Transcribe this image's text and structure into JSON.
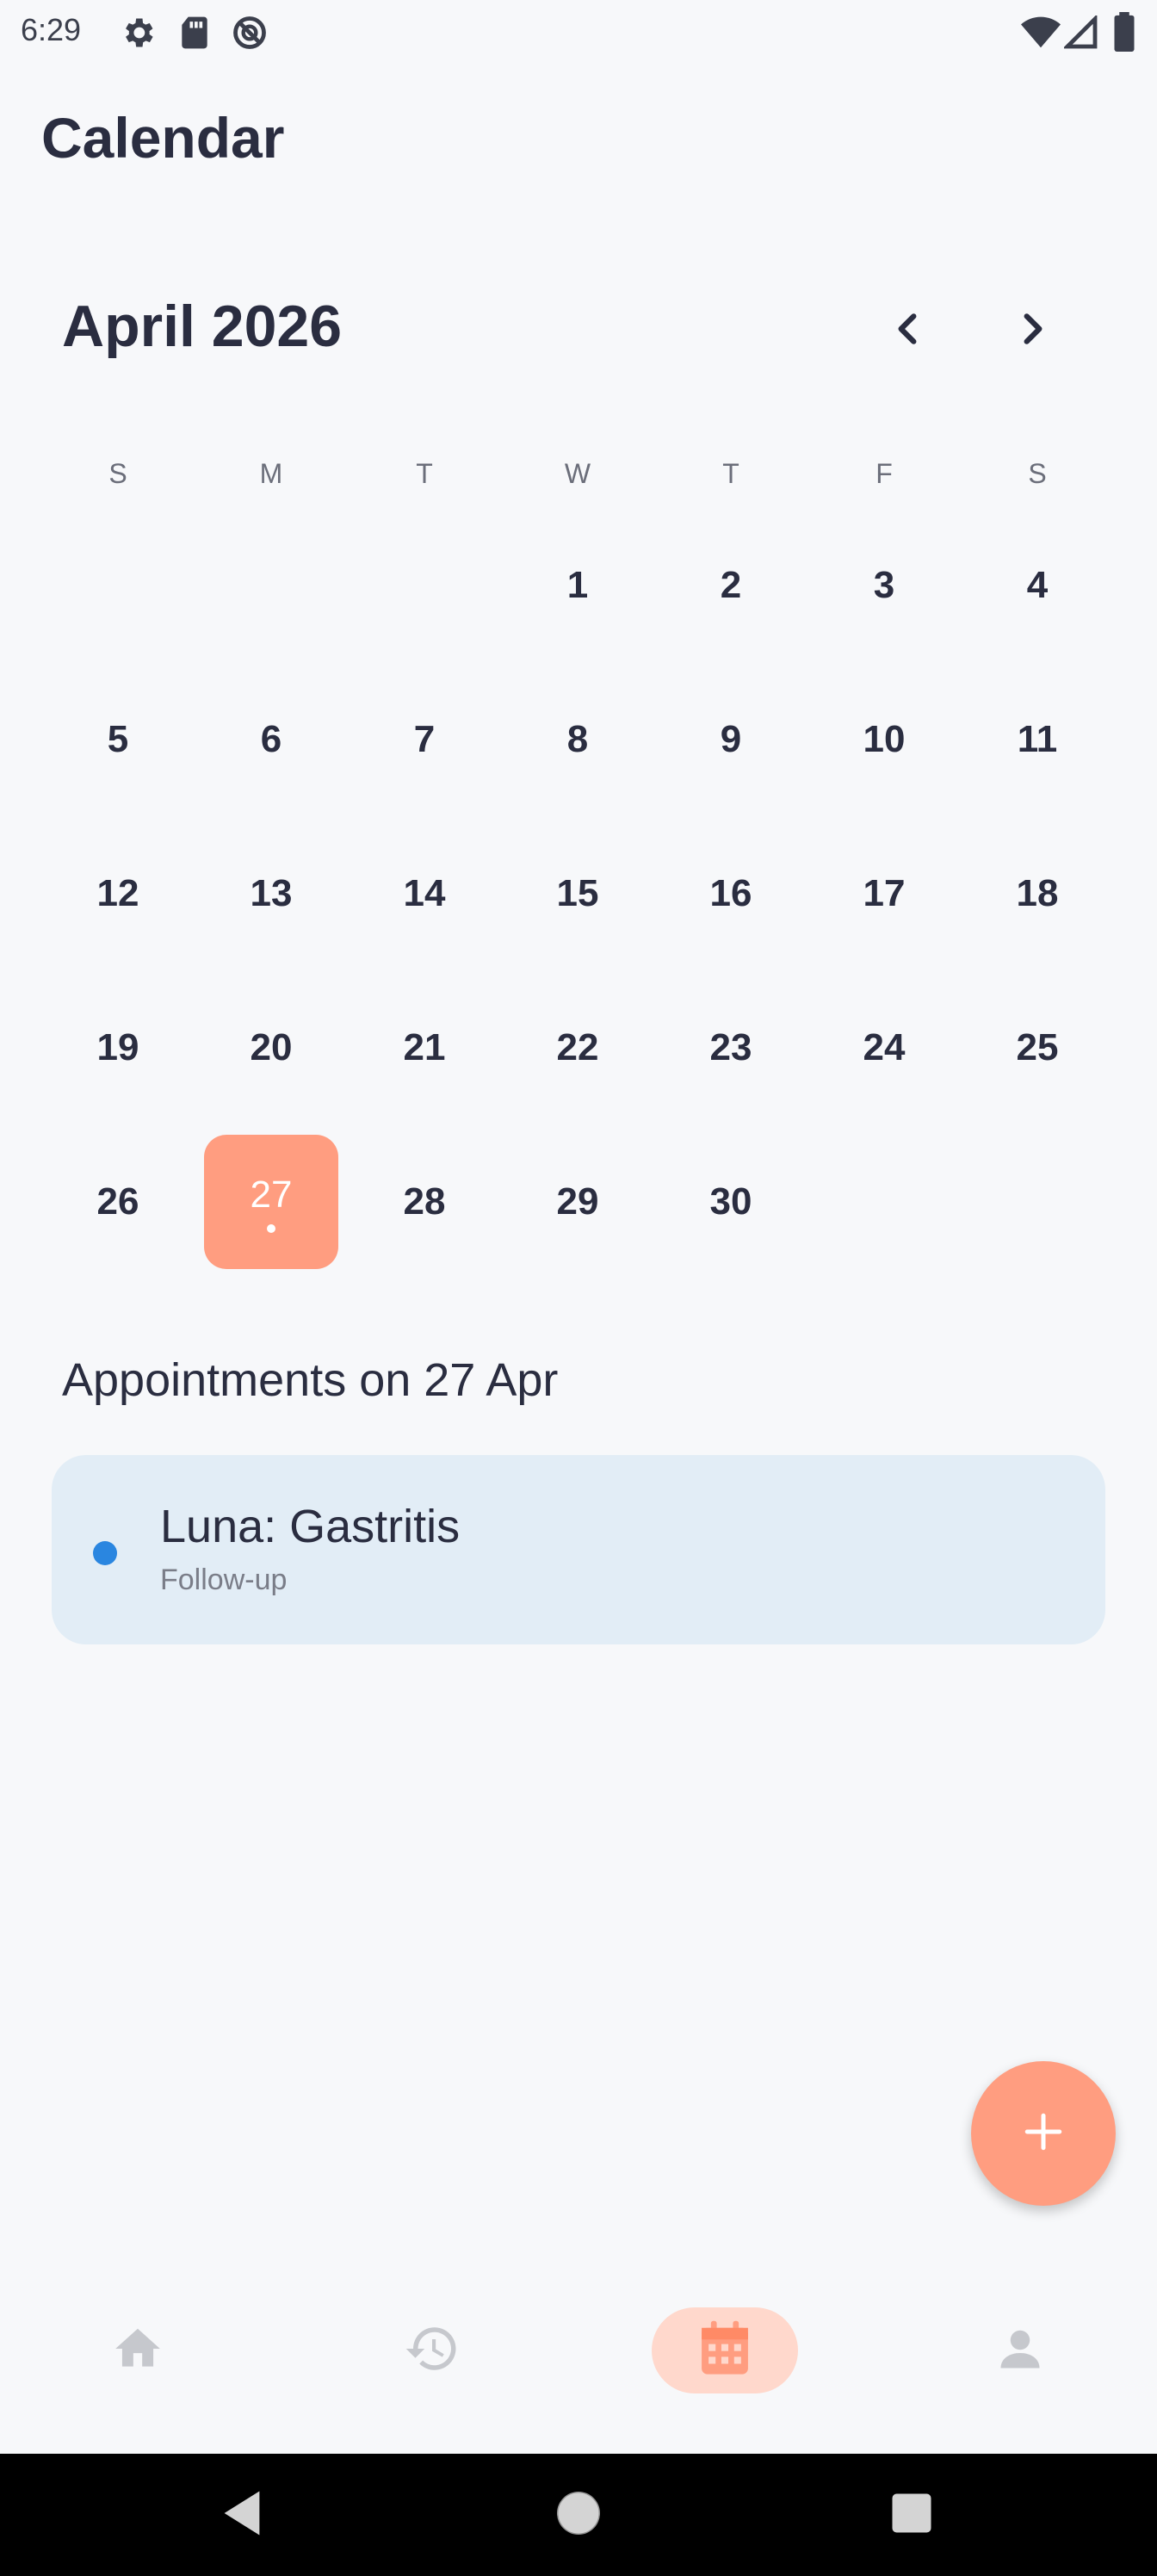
{
  "status_bar": {
    "time": "6:29",
    "left_icons": [
      "settings-icon",
      "sd-card-icon",
      "no-disturb-icon"
    ],
    "right_icons": [
      "wifi-icon",
      "signal-icon",
      "battery-icon"
    ]
  },
  "header": {
    "title": "Calendar"
  },
  "calendar": {
    "month_label": "April 2026",
    "weekdays": [
      "S",
      "M",
      "T",
      "W",
      "T",
      "F",
      "S"
    ],
    "weeks": [
      [
        "",
        "",
        "",
        "1",
        "2",
        "3",
        "4"
      ],
      [
        "5",
        "6",
        "7",
        "8",
        "9",
        "10",
        "11"
      ],
      [
        "12",
        "13",
        "14",
        "15",
        "16",
        "17",
        "18"
      ],
      [
        "19",
        "20",
        "21",
        "22",
        "23",
        "24",
        "25"
      ],
      [
        "26",
        "27",
        "28",
        "29",
        "30",
        "",
        ""
      ]
    ],
    "selected_day": "27",
    "days_with_events": [
      "27"
    ]
  },
  "appointments": {
    "heading": "Appointments on 27 Apr",
    "items": [
      {
        "title": "Luna: Gastritis",
        "subtitle": "Follow-up",
        "dot_color": "#2a86e0"
      }
    ]
  },
  "fab": {
    "icon": "plus-icon"
  },
  "bottom_nav": {
    "items": [
      {
        "name": "home",
        "icon": "home-icon",
        "active": false
      },
      {
        "name": "history",
        "icon": "history-icon",
        "active": false
      },
      {
        "name": "calendar",
        "icon": "calendar-icon",
        "active": true
      },
      {
        "name": "profile",
        "icon": "person-icon",
        "active": false
      }
    ]
  },
  "colors": {
    "accent": "#ff9d80",
    "accent_light": "#ffd8cc",
    "background": "#f7f8fa",
    "card": "#e2edf6",
    "text": "#2a2d40"
  }
}
